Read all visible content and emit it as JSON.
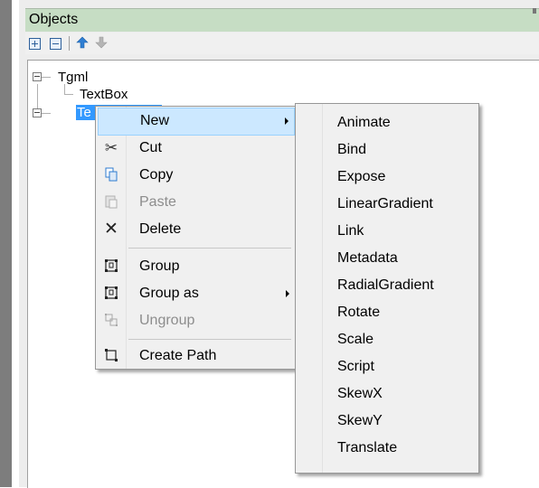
{
  "panel": {
    "title": "Objects"
  },
  "toolbar": {
    "buttons": [
      {
        "name": "expand-all",
        "icon": "plus-box-icon"
      },
      {
        "name": "collapse-all",
        "icon": "minus-box-icon"
      },
      {
        "name": "move-up",
        "icon": "arrow-up-icon"
      },
      {
        "name": "move-down",
        "icon": "arrow-down-icon"
      }
    ]
  },
  "tree": {
    "root": "Tgml",
    "children": [
      "TextBox",
      "Te"
    ]
  },
  "context_menu": {
    "items": [
      {
        "label": "New",
        "icon": "",
        "submenu": true,
        "highlighted": true,
        "disabled": false
      },
      {
        "label": "Cut",
        "icon": "scissors-icon",
        "submenu": false,
        "disabled": false
      },
      {
        "label": "Copy",
        "icon": "copy-icon",
        "submenu": false,
        "disabled": false
      },
      {
        "label": "Paste",
        "icon": "paste-icon",
        "submenu": false,
        "disabled": true
      },
      {
        "label": "Delete",
        "icon": "delete-x-icon",
        "submenu": false,
        "disabled": false
      },
      {
        "label": "Group",
        "icon": "group-icon",
        "submenu": false,
        "disabled": false
      },
      {
        "label": "Group as",
        "icon": "group-as-icon",
        "submenu": true,
        "disabled": false
      },
      {
        "label": "Ungroup",
        "icon": "ungroup-icon",
        "submenu": false,
        "disabled": true
      },
      {
        "label": "Create Path",
        "icon": "create-path-icon",
        "submenu": false,
        "disabled": false
      }
    ]
  },
  "new_submenu": {
    "items": [
      "Animate",
      "Bind",
      "Expose",
      "LinearGradient",
      "Link",
      "Metadata",
      "RadialGradient",
      "Rotate",
      "Scale",
      "Script",
      "SkewX",
      "SkewY",
      "Translate"
    ]
  },
  "colors": {
    "title_bar": "#c6ddc4",
    "selection": "#3399ff",
    "menu_highlight": "#cce8ff",
    "menu_background": "#f0f0f0"
  }
}
